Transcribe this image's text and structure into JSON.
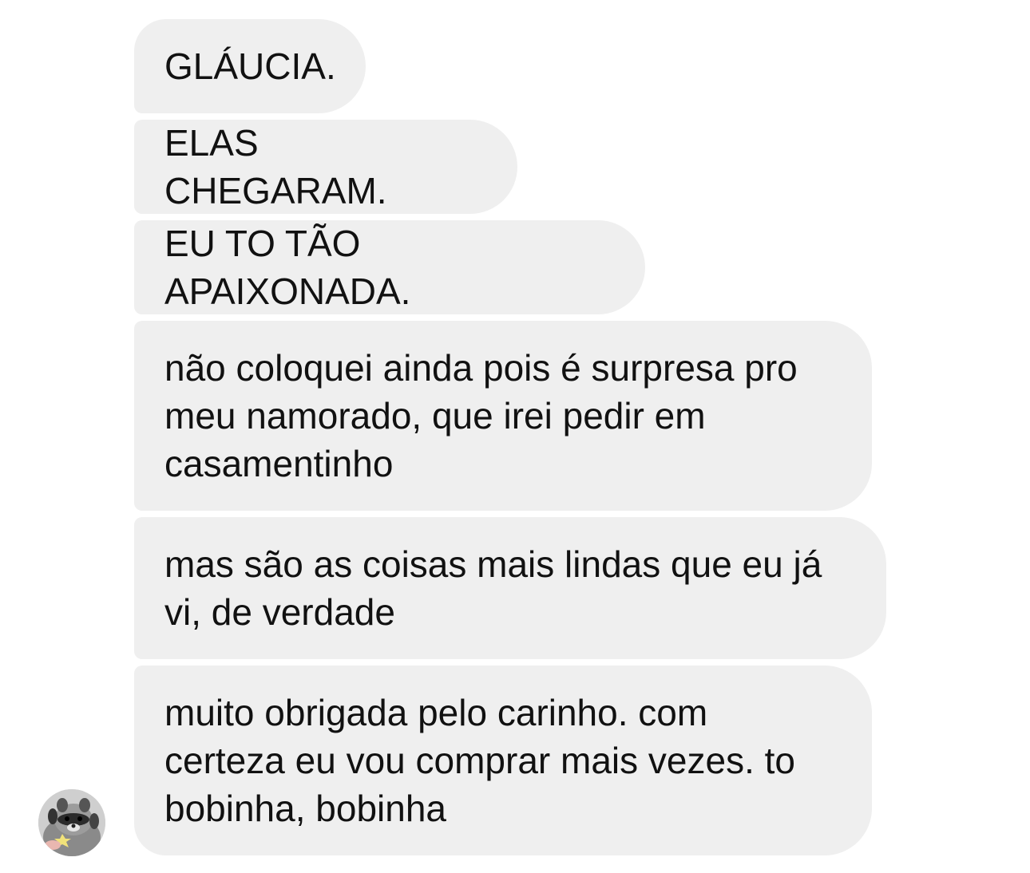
{
  "conversation": {
    "messages": [
      {
        "text": "GLÁUCIA."
      },
      {
        "text": "ELAS CHEGARAM."
      },
      {
        "text": "EU TO TÃO APAIXONADA."
      },
      {
        "text": "não coloquei ainda pois é surpresa pro\nmeu namorado, que irei pedir em\ncasamentinho"
      },
      {
        "text": "mas são as coisas mais lindas que eu já\nvi, de verdade"
      },
      {
        "text": "muito obrigada pelo carinho. com\ncerteza eu vou comprar mais vezes. to\nbobinha, bobinha"
      }
    ]
  },
  "sender": {
    "avatar_icon": "raccoon-photo-avatar"
  },
  "colors": {
    "bubble_background": "#efefef",
    "text": "#111111",
    "page_background": "#ffffff"
  }
}
